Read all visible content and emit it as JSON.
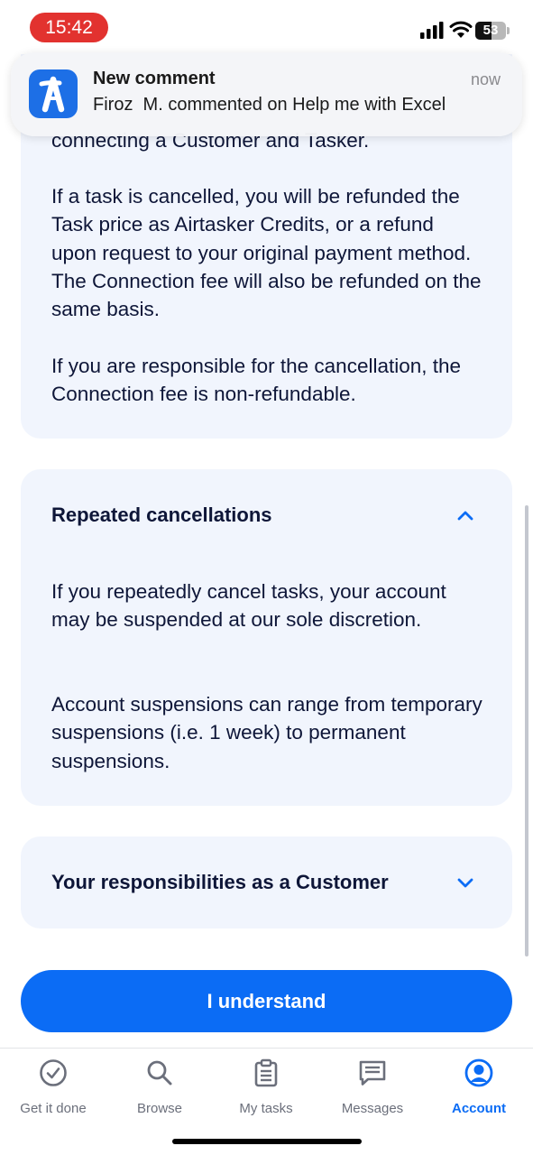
{
  "status_bar": {
    "time": "15:42",
    "battery": "53",
    "battery_level_percent": 53,
    "time_pill_color": "#e2322f"
  },
  "notification": {
    "app_icon": "airtasker-logo",
    "title": "New comment",
    "time": "now",
    "body": "Firoz  M. commented on Help me with Excel"
  },
  "content": {
    "truncated_line": "connecting a Customer and Tasker.",
    "refund_paragraph": "If a task is cancelled, you will be refunded the Task price as Airtasker Credits, or a refund upon request to your original payment method. The Connection fee will also be refunded on the same basis.",
    "responsibility_paragraph": "If you are responsible for the cancellation, the Connection fee is non-refundable.",
    "sections": [
      {
        "title": "Repeated cancellations",
        "expanded": true,
        "paragraphs": [
          "If you repeatedly cancel tasks, your account may be suspended at our sole discretion.",
          "Account suspensions can range from temporary suspensions (i.e. 1 week) to permanent suspensions."
        ]
      },
      {
        "title": "Your responsibilities as a Customer",
        "expanded": false
      }
    ]
  },
  "cta": {
    "label": "I understand",
    "color": "#0b6cf5"
  },
  "tabbar": {
    "active_index": 4,
    "accent": "#0b6cf5",
    "tabs": [
      {
        "label": "Get it done",
        "icon": "check-circle-icon"
      },
      {
        "label": "Browse",
        "icon": "search-icon"
      },
      {
        "label": "My tasks",
        "icon": "clipboard-icon"
      },
      {
        "label": "Messages",
        "icon": "chat-icon"
      },
      {
        "label": "Account",
        "icon": "account-icon"
      }
    ]
  }
}
